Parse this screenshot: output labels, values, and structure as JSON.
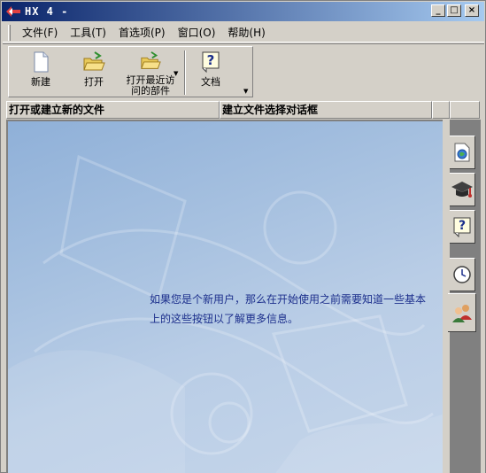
{
  "window": {
    "title": "HX 4 -",
    "controls": {
      "minimize": "_",
      "maximize": "□",
      "close": "×"
    }
  },
  "menu": [
    {
      "label": "文件(F)"
    },
    {
      "label": "工具(T)"
    },
    {
      "label": "首选项(P)"
    },
    {
      "label": "窗口(O)"
    },
    {
      "label": "帮助(H)"
    }
  ],
  "toolbar": {
    "new_label": "新建",
    "open_label": "打开",
    "recent_label_line1": "打开最近访",
    "recent_label_line2": "问的部件",
    "docs_label": "文档"
  },
  "header": {
    "col1": "打开或建立新的文件",
    "col2": "建立文件选择对话框"
  },
  "welcome": {
    "line1": "如果您是个新用户，那么在开始使用之前需要知道一些基本",
    "line2": "上的这些按钮以了解更多信息。"
  },
  "side_tabs": [
    {
      "icon": "globe-document-icon"
    },
    {
      "icon": "graduation-cap-icon"
    },
    {
      "icon": "help-icon"
    },
    {
      "icon": "clock-icon"
    },
    {
      "icon": "users-icon"
    }
  ],
  "colors": {
    "titlebar_start": "#0a246a",
    "titlebar_end": "#a6caf0",
    "welcome_text": "#1c2f8c",
    "pane_background": "#a7c1e0"
  }
}
